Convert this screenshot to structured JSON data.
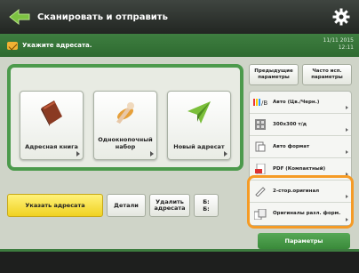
{
  "header": {
    "title": "Сканировать и отправить",
    "back_icon": "back-arrow-icon",
    "settings_icon": "gear-icon"
  },
  "info": {
    "message": "Укажите адресата.",
    "date": "11/11 2015",
    "time": "12:11"
  },
  "destinations": [
    {
      "label": "Адресная книга",
      "icon": "address-book-icon"
    },
    {
      "label": "Однокнопочный набор",
      "icon": "one-touch-icon"
    },
    {
      "label": "Новый адресат",
      "icon": "new-destination-icon"
    }
  ],
  "bottom_buttons": {
    "specify_label": "Указать адресата",
    "details_label": "Детали",
    "delete_label": "Удалить адресата",
    "dest_count": "Б:",
    "dest_count2": "Б:"
  },
  "right": {
    "prev_settings": "Предыдущие параметры",
    "frequent_settings": "Часто исп. параметры",
    "rows": [
      {
        "label": "Авто (Цв./Черн.)",
        "icon": "color-icon"
      },
      {
        "label": "300x300 т/д",
        "icon": "resolution-icon"
      },
      {
        "label": "Авто формат",
        "icon": "scan-size-icon"
      },
      {
        "label": "PDF (Компактный)",
        "icon": "file-format-icon"
      },
      {
        "label": "2-стор.оригинал",
        "icon": "duplex-icon"
      },
      {
        "label": "Оригиналы разл. форм.",
        "icon": "mixed-originals-icon"
      }
    ],
    "options_label": "Параметры"
  },
  "colors": {
    "accent_green": "#4c9a4c",
    "highlight_orange": "#f59b26",
    "yellow_button": "#f0d221"
  }
}
